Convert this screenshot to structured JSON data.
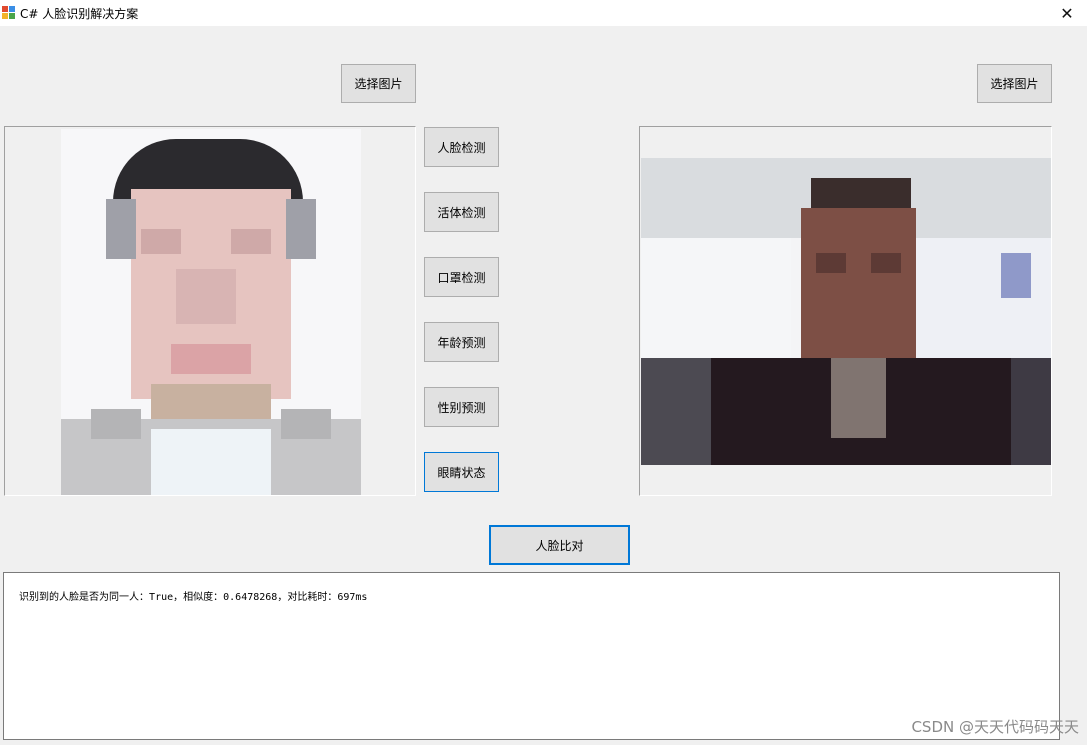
{
  "window": {
    "title": "C#  人脸识别解决方案",
    "close_label": "✕"
  },
  "left_panel": {
    "select_button_label": "选择图片",
    "side_buttons": [
      "人脸检测",
      "活体检测",
      "口罩检测",
      "年龄预测",
      "性别预测",
      "眼睛状态"
    ]
  },
  "right_panel": {
    "select_button_label": "选择图片"
  },
  "compare_button_label": "人脸比对",
  "result": {
    "text": "识别到的人脸是否为同一人：True，相似度：0.6478268，对比耗时：697ms"
  },
  "watermark": "CSDN @天天代码码天天",
  "colors": {
    "focus_border": "#0078d7",
    "button_bg": "#e1e1e1",
    "window_bg": "#f0f0f0"
  },
  "icons": {
    "app": "window-app-icon",
    "close": "close-icon"
  }
}
